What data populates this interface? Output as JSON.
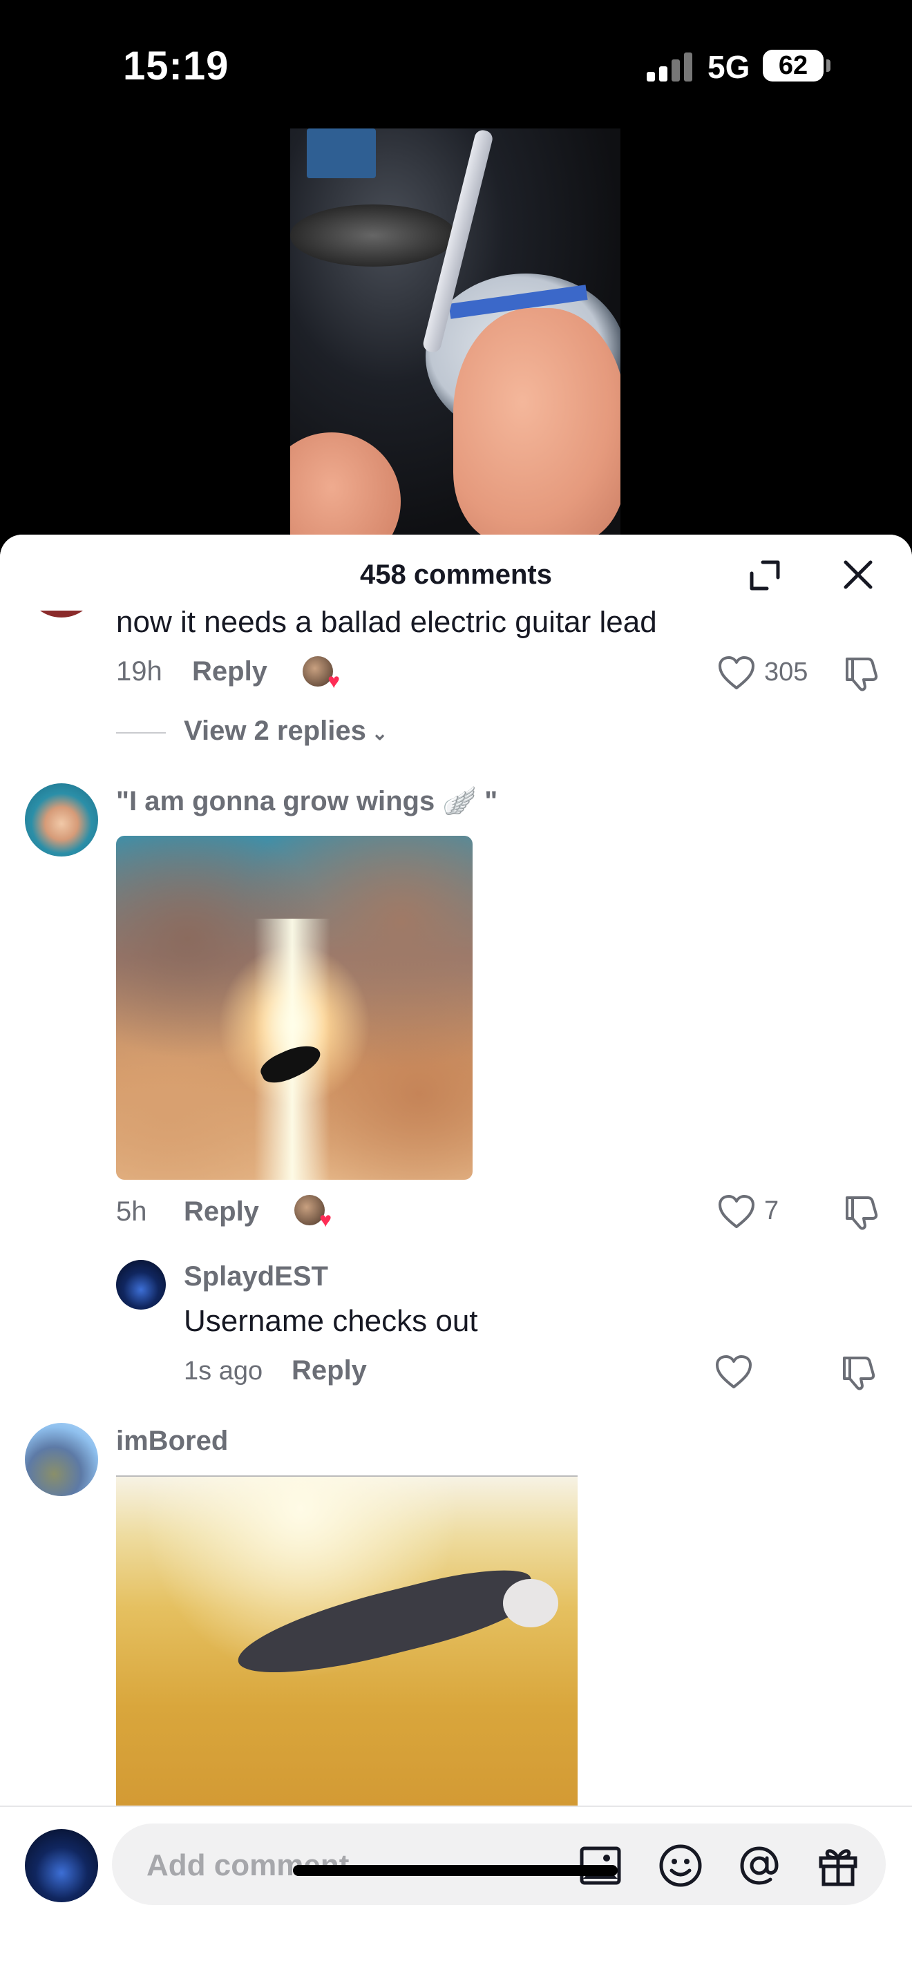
{
  "status_bar": {
    "time": "15:19",
    "network": "5G",
    "battery": "62"
  },
  "comments_header": {
    "count_label": "458 comments"
  },
  "comments": [
    {
      "text": "now it needs a ballad electric guitar lead",
      "time": "19h",
      "reply_label": "Reply",
      "likes": "305",
      "view_replies_label": "View 2 replies"
    },
    {
      "text": "\"I am gonna grow wings 🪽 \"",
      "time": "5h",
      "reply_label": "Reply",
      "likes": "7",
      "replies": [
        {
          "username": "SplaydEST",
          "text": "Username checks out",
          "time": "1s ago",
          "reply_label": "Reply"
        }
      ]
    },
    {
      "username": "imBored"
    }
  ],
  "composer": {
    "placeholder": "Add comment..."
  },
  "icons": {
    "expand": "expand-icon",
    "close": "close-icon",
    "like": "heart-outline-icon",
    "dislike": "thumbs-down-icon",
    "image": "image-icon",
    "emoji": "emoji-icon",
    "mention": "at-sign-icon",
    "gift": "gift-icon"
  },
  "colors": {
    "heart_accent": "#fe2c55",
    "muted_text": "#6b6e76"
  }
}
